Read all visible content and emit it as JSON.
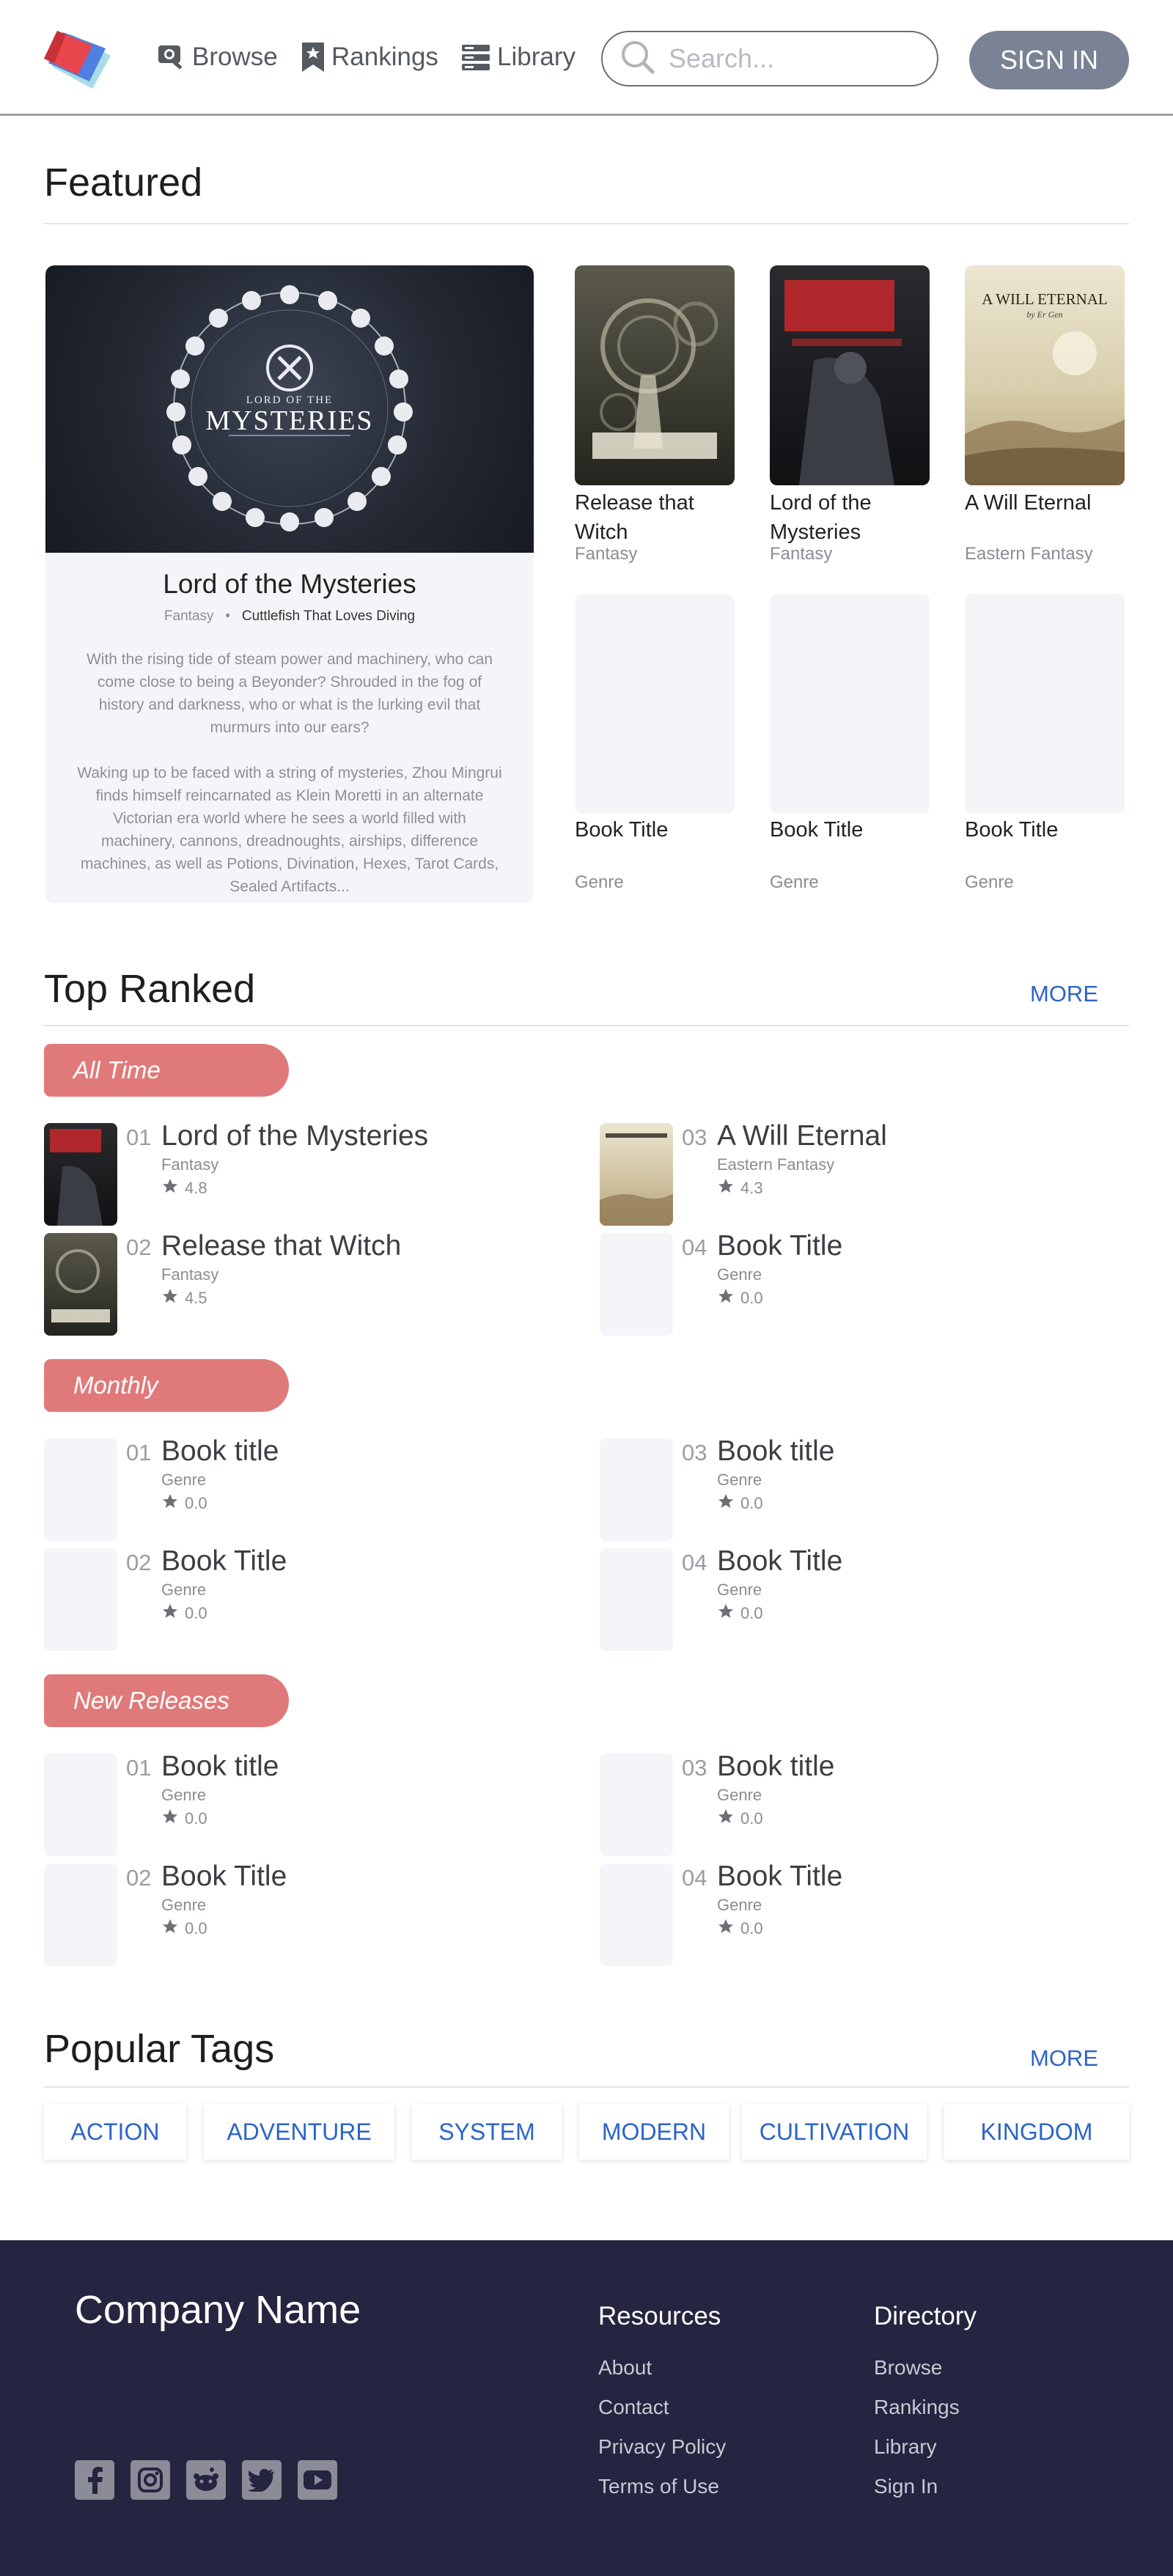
{
  "nav": {
    "browse": "Browse",
    "rankings": "Rankings",
    "library": "Library",
    "search_placeholder": "Search...",
    "sign_in": "SIGN IN"
  },
  "featured": {
    "heading": "Featured",
    "main": {
      "title": "Lord of the Mysteries",
      "genre": "Fantasy",
      "separator": "•",
      "author": "Cuttlefish That Loves Diving",
      "cover_title_small": "LORD OF THE",
      "cover_title_large": "MYSTERIES",
      "desc_1": "With the rising tide of steam power and machinery, who can come close to being a Beyonder? Shrouded in the fog of history and darkness, who or what is the lurking evil that murmurs into our ears?",
      "desc_2": "Waking up to be faced with a string of mysteries, Zhou Mingrui finds himself reincarnated as Klein Moretti in an alternate Victorian era world where he sees a world filled with machinery, cannons, dreadnoughts, airships, difference machines, as well as Potions, Divination, Hexes, Tarot Cards, Sealed Artifacts..."
    },
    "cards": [
      {
        "title": "Release that Witch",
        "genre": "Fantasy"
      },
      {
        "title": "Lord of the Mysteries",
        "genre": "Fantasy"
      },
      {
        "title": "A Will Eternal",
        "genre": "Eastern Fantasy",
        "cover_text": "A WILL ETERNAL",
        "cover_author": "by Er Gen"
      },
      {
        "title": "Book Title",
        "genre": "Genre"
      },
      {
        "title": "Book Title",
        "genre": "Genre"
      },
      {
        "title": "Book Title",
        "genre": "Genre"
      }
    ]
  },
  "top_ranked": {
    "heading": "Top Ranked",
    "more": "MORE",
    "groups": [
      {
        "label": "All Time",
        "items": [
          {
            "num": "01",
            "title": "Lord of the Mysteries",
            "genre": "Fantasy",
            "rating": "4.8"
          },
          {
            "num": "02",
            "title": "Release that Witch",
            "genre": "Fantasy",
            "rating": "4.5"
          },
          {
            "num": "03",
            "title": "A Will Eternal",
            "genre": "Eastern Fantasy",
            "rating": "4.3"
          },
          {
            "num": "04",
            "title": "Book Title",
            "genre": "Genre",
            "rating": "0.0"
          }
        ]
      },
      {
        "label": "Monthly",
        "items": [
          {
            "num": "01",
            "title": "Book title",
            "genre": "Genre",
            "rating": "0.0"
          },
          {
            "num": "02",
            "title": "Book Title",
            "genre": "Genre",
            "rating": "0.0"
          },
          {
            "num": "03",
            "title": "Book title",
            "genre": "Genre",
            "rating": "0.0"
          },
          {
            "num": "04",
            "title": "Book Title",
            "genre": "Genre",
            "rating": "0.0"
          }
        ]
      },
      {
        "label": "New Releases",
        "items": [
          {
            "num": "01",
            "title": "Book title",
            "genre": "Genre",
            "rating": "0.0"
          },
          {
            "num": "02",
            "title": "Book Title",
            "genre": "Genre",
            "rating": "0.0"
          },
          {
            "num": "03",
            "title": "Book title",
            "genre": "Genre",
            "rating": "0.0"
          },
          {
            "num": "04",
            "title": "Book Title",
            "genre": "Genre",
            "rating": "0.0"
          }
        ]
      }
    ]
  },
  "tags": {
    "heading": "Popular Tags",
    "more": "MORE",
    "items": [
      "ACTION",
      "ADVENTURE",
      "SYSTEM",
      "MODERN",
      "CULTIVATION",
      "KINGDOM"
    ]
  },
  "footer": {
    "company": "Company Name",
    "resources": {
      "heading": "Resources",
      "links": [
        "About",
        "Contact",
        "Privacy Policy",
        "Terms of Use"
      ]
    },
    "directory": {
      "heading": "Directory",
      "links": [
        "Browse",
        "Rankings",
        "Library",
        "Sign In"
      ]
    },
    "social_icons": [
      "facebook-icon",
      "instagram-icon",
      "reddit-icon",
      "twitter-icon",
      "youtube-icon"
    ]
  },
  "colors": {
    "accent_pill": "#e07a7a",
    "link_blue": "#2b64c8",
    "sign_in_button": "#7a8395",
    "footer_bg": "#252541",
    "card_placeholder": "#f4f5f9"
  }
}
